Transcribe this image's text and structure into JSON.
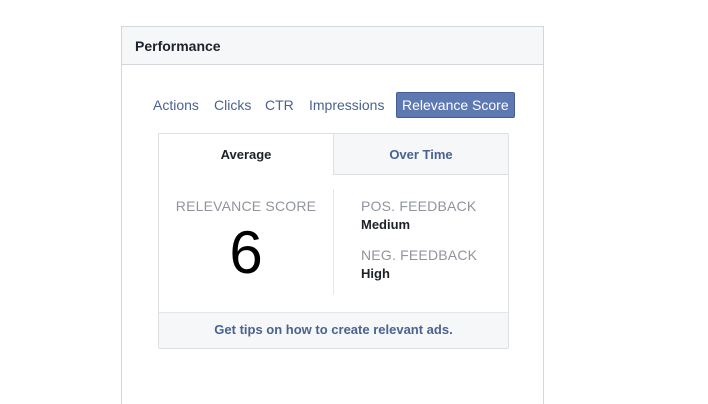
{
  "panel": {
    "title": "Performance"
  },
  "metric_tabs": [
    {
      "label": "Actions"
    },
    {
      "label": "Clicks"
    },
    {
      "label": "CTR"
    },
    {
      "label": "Impressions"
    },
    {
      "label": "Relevance Score",
      "active": true
    }
  ],
  "view_tabs": {
    "average": "Average",
    "over_time": "Over Time"
  },
  "relevance": {
    "label": "RELEVANCE SCORE",
    "value": "6"
  },
  "feedback": {
    "positive_label": "POS. FEEDBACK",
    "positive_value": "Medium",
    "negative_label": "NEG. FEEDBACK",
    "negative_value": "High"
  },
  "footer": {
    "link_text": "Get tips on how to create relevant ads."
  },
  "colors": {
    "accent": "#5e78b1",
    "link": "#4b6290",
    "muted": "#90949c"
  }
}
